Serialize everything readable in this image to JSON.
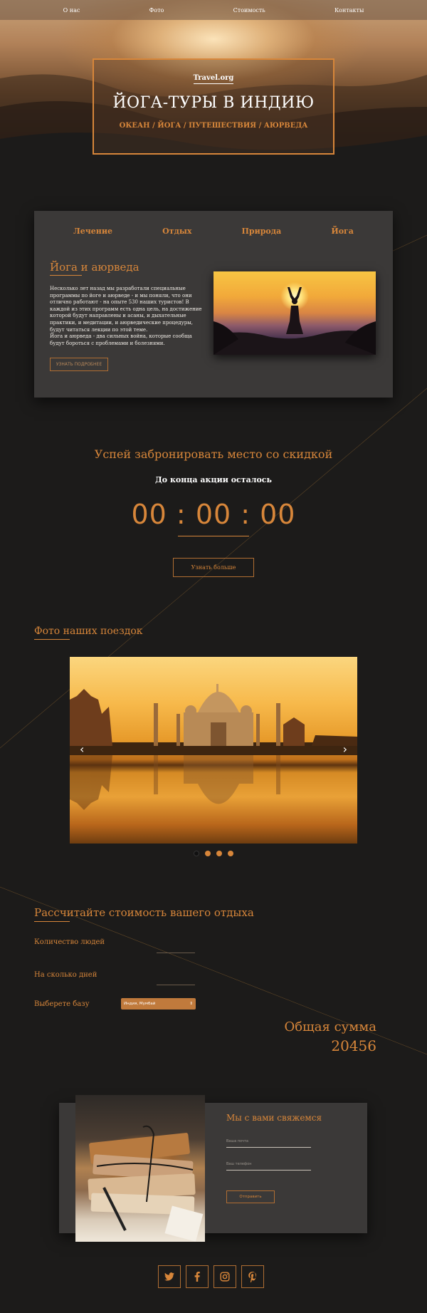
{
  "nav": {
    "items": [
      "О нас",
      "Фото",
      "Стоимость",
      "Контакты"
    ]
  },
  "hero": {
    "logo": "Travel.org",
    "title": "ЙОГА-ТУРЫ В ИНДИЮ",
    "tags": "ОКЕАН / ЙОГА / ПУТЕШЕСТВИЯ / АЮРВЕДА"
  },
  "card": {
    "tabs": [
      "Лечение",
      "Отдых",
      "Природа",
      "Йога"
    ],
    "heading": "Йога и аюрведа",
    "text": "Несколько лет назад мы разработали специальные программы по йоге и аюрведе - и мы поняли, что они отлично работают - на опыте 530 наших туристов! В каждой из этих программ есть одна цель, на достижение которой будут направлены и асаны, и дыхательные практики, и медитации, и аюрведические процедуры, будут читаться лекции по этой теме.",
    "text2": "Йога и аюрведа - два сильных война, которые сообща будут бороться с проблемами и болезнями.",
    "button": "УЗНАТЬ ПОДРОБНЕЕ"
  },
  "countdown": {
    "title": "Успей забронировать место со скидкой",
    "subtitle": "До конца акции осталось",
    "timer": "00 : 00 : 00",
    "button": "Узнать больше"
  },
  "photos": {
    "title": "Фото наших поездок",
    "prev": "‹",
    "next": "›",
    "slides": 4,
    "active_slide": 1
  },
  "calculator": {
    "title": "Рассчитайте стоимость вашего отдыха",
    "people_label": "Количество людей",
    "days_label": "На сколько дней",
    "base_label": "Выберете базу",
    "base_value": "Индия, Мумбай",
    "base_arrow": "⇕",
    "total_label": "Общая сумма",
    "total_value": "20456"
  },
  "contact": {
    "title": "Мы с вами свяжемся",
    "email_placeholder": "Ваша почта",
    "phone_placeholder": "Ваш телефон",
    "submit": "Отправить"
  },
  "social": {
    "icons": [
      "twitter-icon",
      "facebook-icon",
      "instagram-icon",
      "pinterest-icon"
    ]
  },
  "colors": {
    "accent": "#d7863a",
    "background": "#1c1b1a",
    "card": "#3b3938"
  }
}
